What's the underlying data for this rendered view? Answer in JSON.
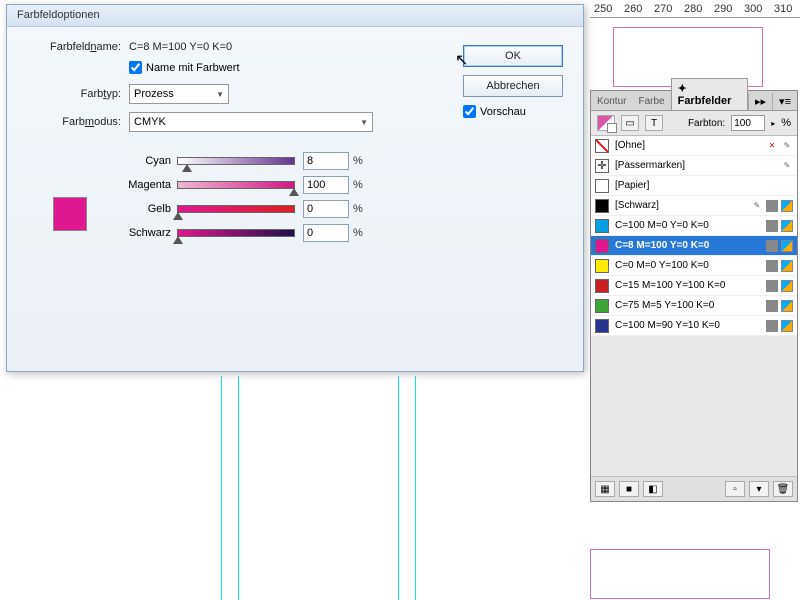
{
  "ruler": {
    "ticks": [
      "250",
      "260",
      "270",
      "280",
      "290",
      "300",
      "310"
    ]
  },
  "dialog": {
    "title": "Farbfeldoptionen",
    "name_label": "Farbfeldname:",
    "name_value": "C=8 M=100 Y=0 K=0",
    "name_with_value": "Name mit Farbwert",
    "farbtyp_label": "Farbtyp:",
    "farbtyp_value": "Prozess",
    "farbmodus_label": "Farbmodus:",
    "farbmodus_value": "CMYK",
    "ok": "OK",
    "cancel": "Abbrechen",
    "preview": "Vorschau",
    "pct": "%",
    "channels": {
      "cyan": {
        "label": "Cyan",
        "value": "8",
        "pos": 8,
        "gradient": "linear-gradient(to right,#fff,#65338e)"
      },
      "magenta": {
        "label": "Magenta",
        "value": "100",
        "pos": 100,
        "gradient": "linear-gradient(to right,#f3b6d4,#d01884)"
      },
      "gelb": {
        "label": "Gelb",
        "value": "0",
        "pos": 0,
        "gradient": "linear-gradient(to right,#e01890,#d82020)"
      },
      "schwarz": {
        "label": "Schwarz",
        "value": "0",
        "pos": 0,
        "gradient": "linear-gradient(to right,#e01890,#20104a)"
      }
    },
    "swatch_preview_color": "#e01890"
  },
  "panel": {
    "tabs": {
      "kontur": "Kontur",
      "farbe": "Farbe",
      "farbfelder": "Farbfelder"
    },
    "tint_label": "Farbton:",
    "tint_value": "100",
    "tint_pct": "%",
    "swatches": [
      {
        "name": "[Ohne]",
        "color": "#ffffff",
        "none": true,
        "locked": true,
        "noedit": true
      },
      {
        "name": "[Passermarken]",
        "color": "#ffffff",
        "reg": true,
        "locked": true
      },
      {
        "name": "[Papier]",
        "color": "#ffffff"
      },
      {
        "name": "[Schwarz]",
        "color": "#000000",
        "locked": true,
        "cmyk": true
      },
      {
        "name": "C=100 M=0 Y=0 K=0",
        "color": "#009fe3",
        "cmyk": true
      },
      {
        "name": "C=8 M=100 Y=0 K=0",
        "color": "#e01890",
        "cmyk": true,
        "selected": true
      },
      {
        "name": "C=0 M=0 Y=100 K=0",
        "color": "#ffed00",
        "cmyk": true
      },
      {
        "name": "C=15 M=100 Y=100 K=0",
        "color": "#c92020",
        "cmyk": true
      },
      {
        "name": "C=75 M=5 Y=100 K=0",
        "color": "#3aa535",
        "cmyk": true
      },
      {
        "name": "C=100 M=90 Y=10 K=0",
        "color": "#27348b",
        "cmyk": true
      }
    ]
  }
}
